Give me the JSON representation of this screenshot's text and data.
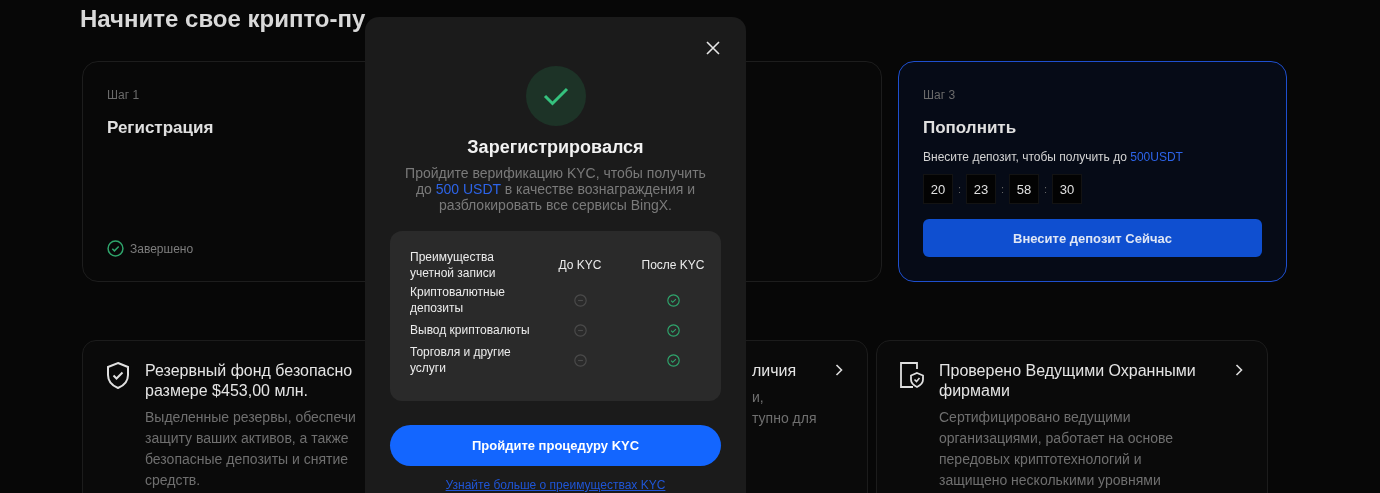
{
  "heading": "Начните свое крипто-пу",
  "steps": [
    {
      "kind": "completed",
      "label": "Шаг 1",
      "title": "Регистрация",
      "status": "Завершено"
    },
    {
      "kind": "deposit",
      "label": "Шаг 3",
      "title": "Пополнить",
      "description": {
        "before": "Внесите депозит, чтобы получить до ",
        "highlight": "500USDT"
      },
      "timer": [
        "20",
        "23",
        "58",
        "30"
      ],
      "timer_separator": ":",
      "button": "Внесите депозит Сейчас"
    }
  ],
  "features": [
    {
      "kind": "shield",
      "chevron": false,
      "title_lines": [
        "Резервный фонд безопасно",
        "размере $453,00 млн."
      ],
      "body_lines": [
        "Выделенные резервы, обеспечи",
        "защиту ваших активов, а также",
        "безопасные депозиты и снятие",
        "средств."
      ]
    },
    {
      "kind": "covered",
      "chevron": true,
      "title_lines": [
        "личия"
      ],
      "body_lines": [
        "и,",
        "тупно для"
      ]
    },
    {
      "kind": "certificate",
      "chevron": true,
      "title_lines": [
        "Проверено Ведущими Охранными",
        "фирмами"
      ],
      "body_lines": [
        "Сертифицировано ведущими",
        "организациями, работает на основе",
        "передовых криптотехнологий и",
        "защищено несколькими уровнями"
      ]
    }
  ],
  "modal": {
    "title": "Зарегистрировался",
    "description": {
      "before": "Пройдите верификацию KYC, чтобы получить до ",
      "highlight": "500 USDT",
      "after": " в качестве вознаграждения и разблокировать все сервисы BingX."
    },
    "table": {
      "columns": [
        "Преимущества учетной записи",
        "До KYC",
        "После KYC"
      ],
      "rows": [
        {
          "label": "Криптовалютные депозиты",
          "before_kyc": false,
          "after_kyc": true
        },
        {
          "label": "Вывод криптовалюты",
          "before_kyc": false,
          "after_kyc": true
        },
        {
          "label": "Торговля и другие услуги",
          "before_kyc": false,
          "after_kyc": true
        }
      ]
    },
    "button": "Пройдите процедуру KYC",
    "link": "Узнайте больше о преимуществах KYC"
  }
}
